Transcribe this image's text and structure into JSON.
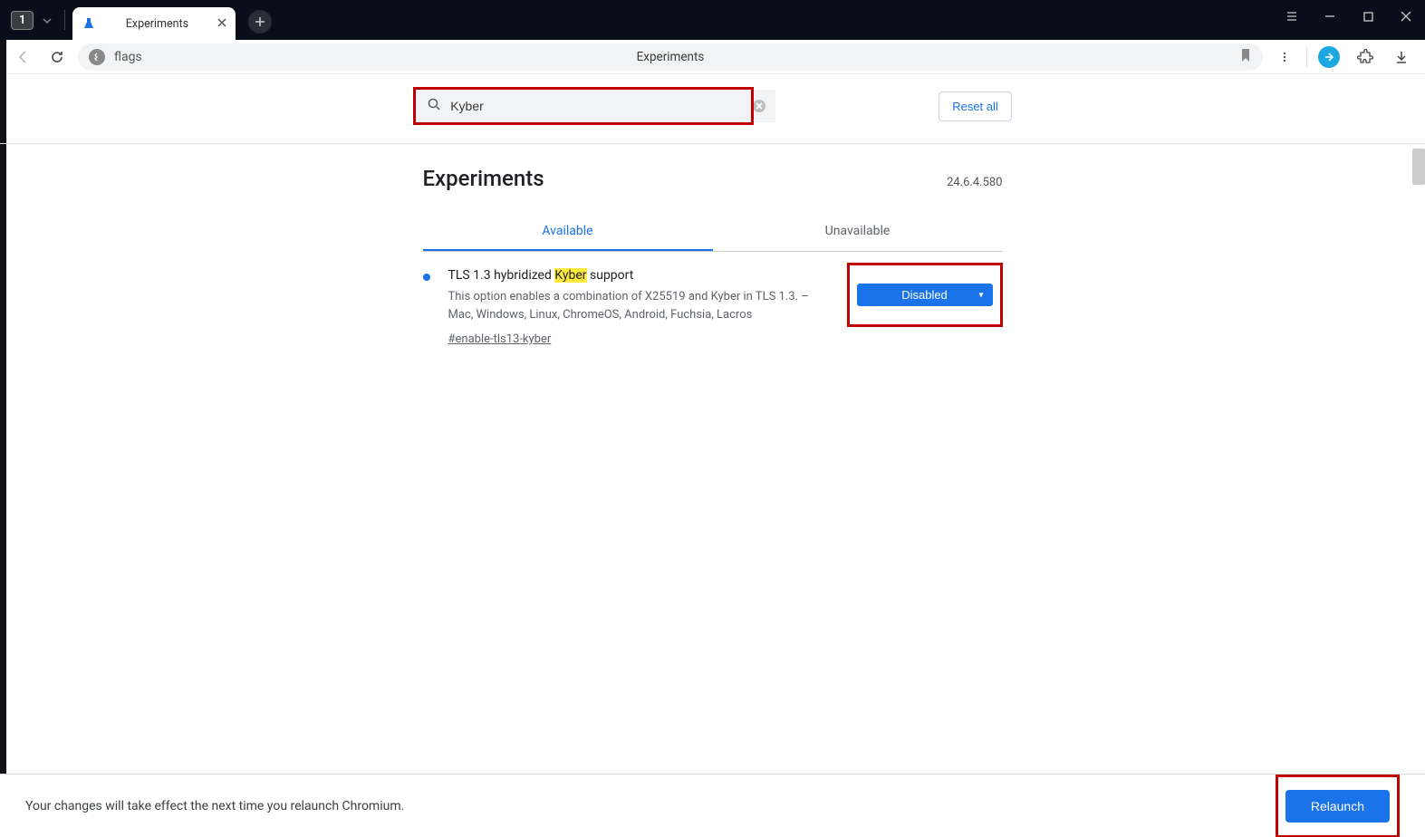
{
  "titlebar": {
    "tab_count": "1",
    "tab_title": "Experiments"
  },
  "addressbar": {
    "url_text": "flags",
    "page_title": "Experiments"
  },
  "search": {
    "value": "Kyber",
    "reset_label": "Reset all"
  },
  "page": {
    "heading": "Experiments",
    "version": "24.6.4.580"
  },
  "tabs": {
    "available": "Available",
    "unavailable": "Unavailable"
  },
  "flag": {
    "title_pre": "TLS 1.3 hybridized ",
    "title_hl": "Kyber",
    "title_post": " support",
    "desc": "This option enables a combination of X25519 and Kyber in TLS 1.3. – Mac, Windows, Linux, ChromeOS, Android, Fuchsia, Lacros",
    "hash": "#enable-tls13-kyber",
    "select_value": "Disabled"
  },
  "footer": {
    "message": "Your changes will take effect the next time you relaunch Chromium.",
    "relaunch_label": "Relaunch"
  }
}
